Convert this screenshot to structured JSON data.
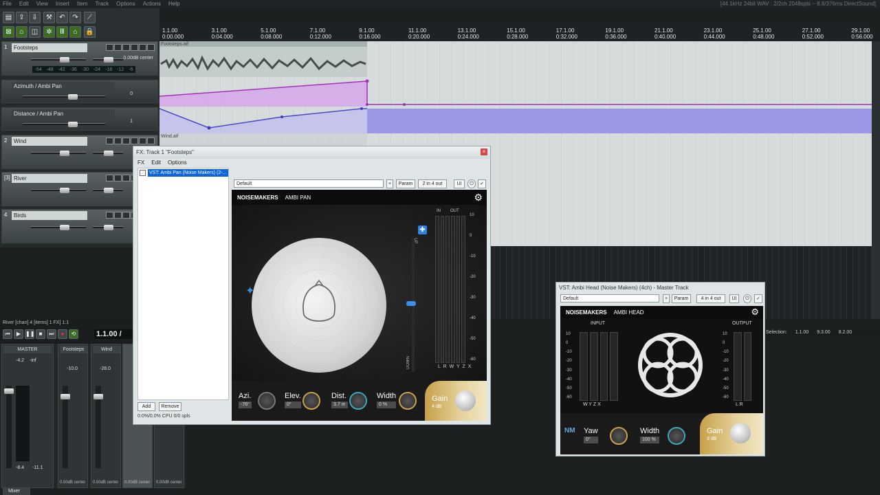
{
  "menu": {
    "items": [
      "File",
      "Edit",
      "View",
      "Insert",
      "Item",
      "Track",
      "Options",
      "Actions",
      "Help"
    ]
  },
  "status": {
    "readout": "[44.1kHz 24bit WAV : 2/2ch 2048spls ~ 8.8/376ms DirectSound]"
  },
  "ruler": {
    "marks": [
      "1.1.00",
      "3.1.00",
      "5.1.00",
      "7.1.00",
      "9.1.00",
      "11.1.00",
      "13.1.00",
      "15.1.00",
      "17.1.00",
      "19.1.00",
      "21.1.00",
      "23.1.00",
      "25.1.00",
      "27.1.00",
      "29.1.00"
    ],
    "times": [
      "0:00.000",
      "0:04.000",
      "0:08.000",
      "0:12.000",
      "0:16.000",
      "0:20.000",
      "0:24.000",
      "0:28.000",
      "0:32.000",
      "0:36.000",
      "0:40.000",
      "0:44.000",
      "0:48.000",
      "0:52.000",
      "0:56.000"
    ]
  },
  "tracks": [
    {
      "num": "1",
      "name": "Footsteps",
      "vol": "0.00dB center"
    },
    {
      "num": "",
      "name": "Azimuth / Ambi Pan",
      "vol": "0"
    },
    {
      "num": "",
      "name": "Distance / Ambi Pan",
      "vol": "1"
    },
    {
      "num": "2",
      "name": "Wind",
      "vol": ""
    },
    {
      "num": "[3]",
      "name": "River",
      "vol": ""
    },
    {
      "num": "4",
      "name": "Birds",
      "vol": ""
    }
  ],
  "meter_scale": [
    "-54",
    "-48",
    "-42",
    "-36",
    "-30",
    "-24",
    "-18",
    "-12",
    "-6"
  ],
  "items": {
    "footsteps": "Footsteps.aif",
    "wind": "Wind.aif"
  },
  "transport": {
    "info": "River [chan] 4 [items] 1 FX] 1:1",
    "time": "1.1.00 /"
  },
  "mixer": {
    "tab": "Mixer",
    "master": "MASTER",
    "strips": [
      "Footsteps",
      "Wind"
    ],
    "master_vals": [
      "-4.2",
      "-inf",
      "-8.4",
      "-11.1"
    ],
    "foot_val": "-10.0",
    "wind_val": "-28.0",
    "footer": [
      "0.00dB center",
      "0.00dB center",
      "0.00dB center",
      "0.00dB center"
    ]
  },
  "fx": {
    "title": "FX: Track 1 \"Footsteps\"",
    "menu": [
      "FX",
      "Edit",
      "Options"
    ],
    "item": "VST: Ambi Pan (Noise Makers) (2-...",
    "preset": "Default",
    "param": "Param",
    "io": "2 in 4 out",
    "ui": "UI",
    "add": "Add",
    "remove": "Remove",
    "cpu": "0.0%/0.0% CPU 0/0 spls"
  },
  "ambipan": {
    "brand": "NOISEMAKERS",
    "product": "AMBI PAN",
    "meter_in": "IN",
    "meter_out": "OUT",
    "up": "UP",
    "down": "DOWN",
    "scale": [
      "10",
      "0",
      "-10",
      "-20",
      "-30",
      "-40",
      "-50",
      "-60"
    ],
    "channels": "L R W Y Z X",
    "azi": {
      "label": "Azi.",
      "value": "-76°"
    },
    "elev": {
      "label": "Elev.",
      "value": "0°"
    },
    "dist": {
      "label": "Dist.",
      "value": "3.7 m"
    },
    "width": {
      "label": "Width",
      "value": "0 %"
    },
    "gain": {
      "label": "Gain",
      "value": "4 dB"
    }
  },
  "master": {
    "title": "VST: Ambi Head (Noise Makers) (4ch) - Master Track",
    "preset": "Default",
    "param": "Param",
    "io": "4 in 4 out",
    "ui": "UI",
    "brand": "NOISEMAKERS",
    "product": "AMBI HEAD",
    "input": "INPUT",
    "output": "OUTPUT",
    "scale": [
      "10",
      "0",
      "-10",
      "-20",
      "-30",
      "-40",
      "-50",
      "-60"
    ],
    "in_ch": "W  Y  Z  X",
    "out_ch": "L  R",
    "yaw": {
      "label": "Yaw",
      "value": "0°"
    },
    "width": {
      "label": "Width",
      "value": "100 %"
    },
    "gain": {
      "label": "Gain",
      "value": "3 dB"
    }
  },
  "selection": {
    "label": "Selection:",
    "start": "1.1.00",
    "end": "9.3.00",
    "len": "8.2.00"
  }
}
